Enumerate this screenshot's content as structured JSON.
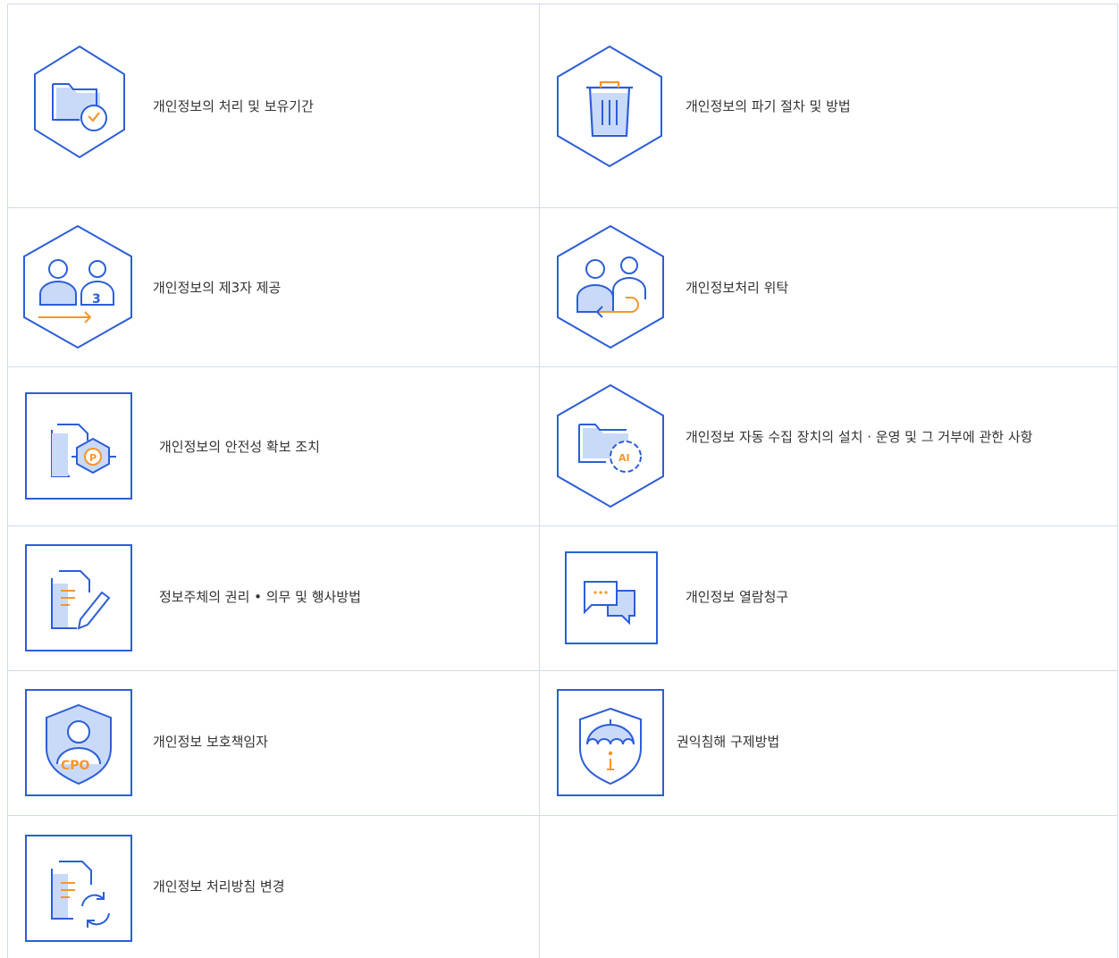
{
  "items": [
    {
      "label": "개인정보의 처리 및 보유기간",
      "icon": "folder-clock-icon"
    },
    {
      "label": "개인정보의 파기 절차 및 방법",
      "icon": "trash-icon"
    },
    {
      "label": "개인정보의 제3자 제공",
      "icon": "users-share-icon"
    },
    {
      "label": "개인정보처리 위탁",
      "icon": "users-return-icon"
    },
    {
      "label": "개인정보의 안전성 확보 조치",
      "icon": "document-shield-icon"
    },
    {
      "label": "개인정보 자동 수집 장치의 설치 · 운영 및 그 거부에 관한 사항",
      "icon": "folder-gear-ai-icon"
    },
    {
      "label": "정보주체의 권리 • 의무 및 행사방법",
      "icon": "document-pen-icon"
    },
    {
      "label": "개인정보 열람청구",
      "icon": "chat-bubbles-icon"
    },
    {
      "label": "개인정보 보호책임자",
      "icon": "cpo-shield-icon"
    },
    {
      "label": "권익침해 구제방법",
      "icon": "umbrella-shield-icon"
    },
    {
      "label": "개인정보 처리방침 변경",
      "icon": "document-refresh-icon"
    }
  ],
  "colors": {
    "primary": "#2c5ed8",
    "light": "#c9daf8",
    "accent": "#f5962a",
    "border": "#d3dbe6"
  }
}
